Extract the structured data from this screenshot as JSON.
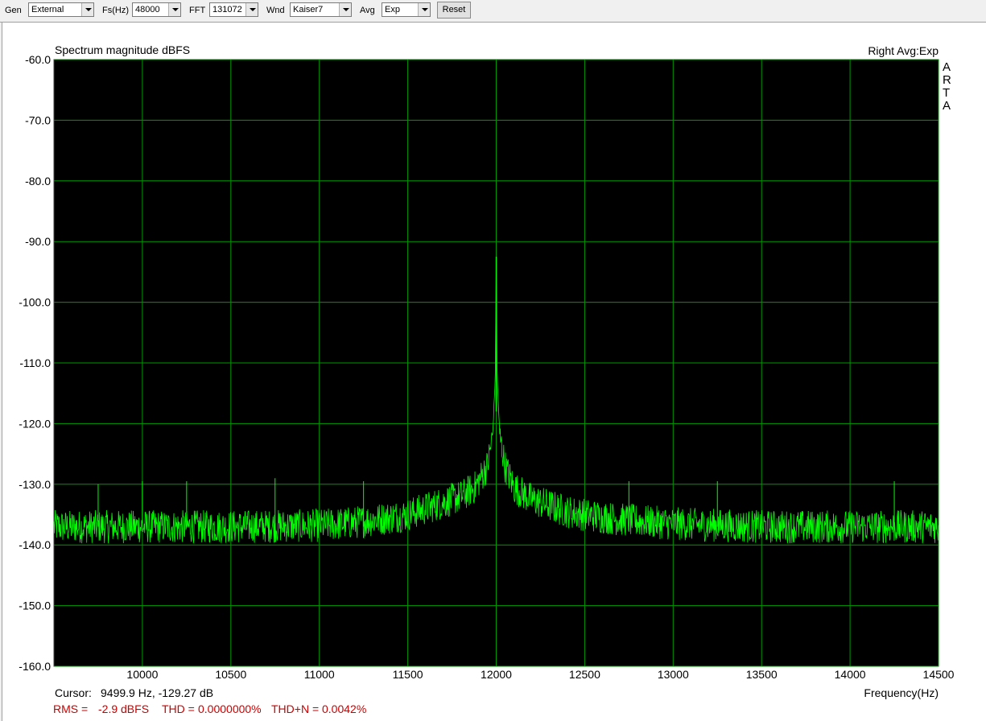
{
  "toolbar": {
    "gen_label": "Gen",
    "gen_value": "External",
    "fs_label": "Fs(Hz)",
    "fs_value": "48000",
    "fft_label": "FFT",
    "fft_value": "131072",
    "wnd_label": "Wnd",
    "wnd_value": "Kaiser7",
    "avg_label": "Avg",
    "avg_value": "Exp",
    "reset_label": "Reset"
  },
  "colors": {
    "plot_background": "#000000",
    "grid": "#009a00",
    "trace": "#00ff00",
    "stats_text": "#cc0000"
  },
  "chart_data": {
    "type": "line",
    "title": "Spectrum magnitude dBFS",
    "channel_label": "Right Avg:Exp",
    "watermark": [
      "A",
      "R",
      "T",
      "A"
    ],
    "xlabel": "Frequency(Hz)",
    "ylabel": "",
    "xlim": [
      9500,
      14500
    ],
    "ylim": [
      -160,
      -60
    ],
    "x_ticks": [
      "10000",
      "10500",
      "11000",
      "11500",
      "12000",
      "12500",
      "13000",
      "13500",
      "14000",
      "14500"
    ],
    "y_ticks": [
      "-60.0",
      "-70.0",
      "-80.0",
      "-90.0",
      "-100.0",
      "-110.0",
      "-120.0",
      "-130.0",
      "-140.0",
      "-150.0",
      "-160.0"
    ],
    "grid": true,
    "noise_floor_db": -137,
    "series": [
      {
        "points": [
          [
            9500,
            -137
          ],
          [
            10000,
            -137
          ],
          [
            10500,
            -137
          ],
          [
            11000,
            -136.8
          ],
          [
            11200,
            -136.3
          ],
          [
            11400,
            -135.5
          ],
          [
            11500,
            -135
          ],
          [
            11600,
            -134
          ],
          [
            11700,
            -133
          ],
          [
            11800,
            -132
          ],
          [
            11880,
            -130.5
          ],
          [
            11950,
            -127
          ],
          [
            11980,
            -122
          ],
          [
            11995,
            -112
          ],
          [
            12000,
            -92.5
          ],
          [
            12005,
            -112
          ],
          [
            12020,
            -122
          ],
          [
            12050,
            -127
          ],
          [
            12100,
            -130.5
          ],
          [
            12200,
            -132.5
          ],
          [
            12300,
            -133.5
          ],
          [
            12400,
            -134.5
          ],
          [
            12500,
            -135
          ],
          [
            12700,
            -135.8
          ],
          [
            13000,
            -136.5
          ],
          [
            13500,
            -137
          ],
          [
            14000,
            -137
          ],
          [
            14500,
            -137
          ]
        ]
      }
    ],
    "spurs": [
      {
        "x": 9750,
        "y": -130
      },
      {
        "x": 10000,
        "y": -129.5
      },
      {
        "x": 10250,
        "y": -129.5
      },
      {
        "x": 10750,
        "y": -129
      },
      {
        "x": 11250,
        "y": -129.5
      },
      {
        "x": 12750,
        "y": -129.5
      },
      {
        "x": 13250,
        "y": -129.5
      },
      {
        "x": 14250,
        "y": -129.5
      }
    ]
  },
  "cursor": {
    "label": "Cursor:",
    "value": "9499.9 Hz, -129.27 dB"
  },
  "stats": {
    "rms_label": "RMS =",
    "rms_value": "-2.9 dBFS",
    "thd_label": "THD =",
    "thd_value": "0.0000000%",
    "thdn_label": "THD+N =",
    "thdn_value": "0.0042%"
  }
}
